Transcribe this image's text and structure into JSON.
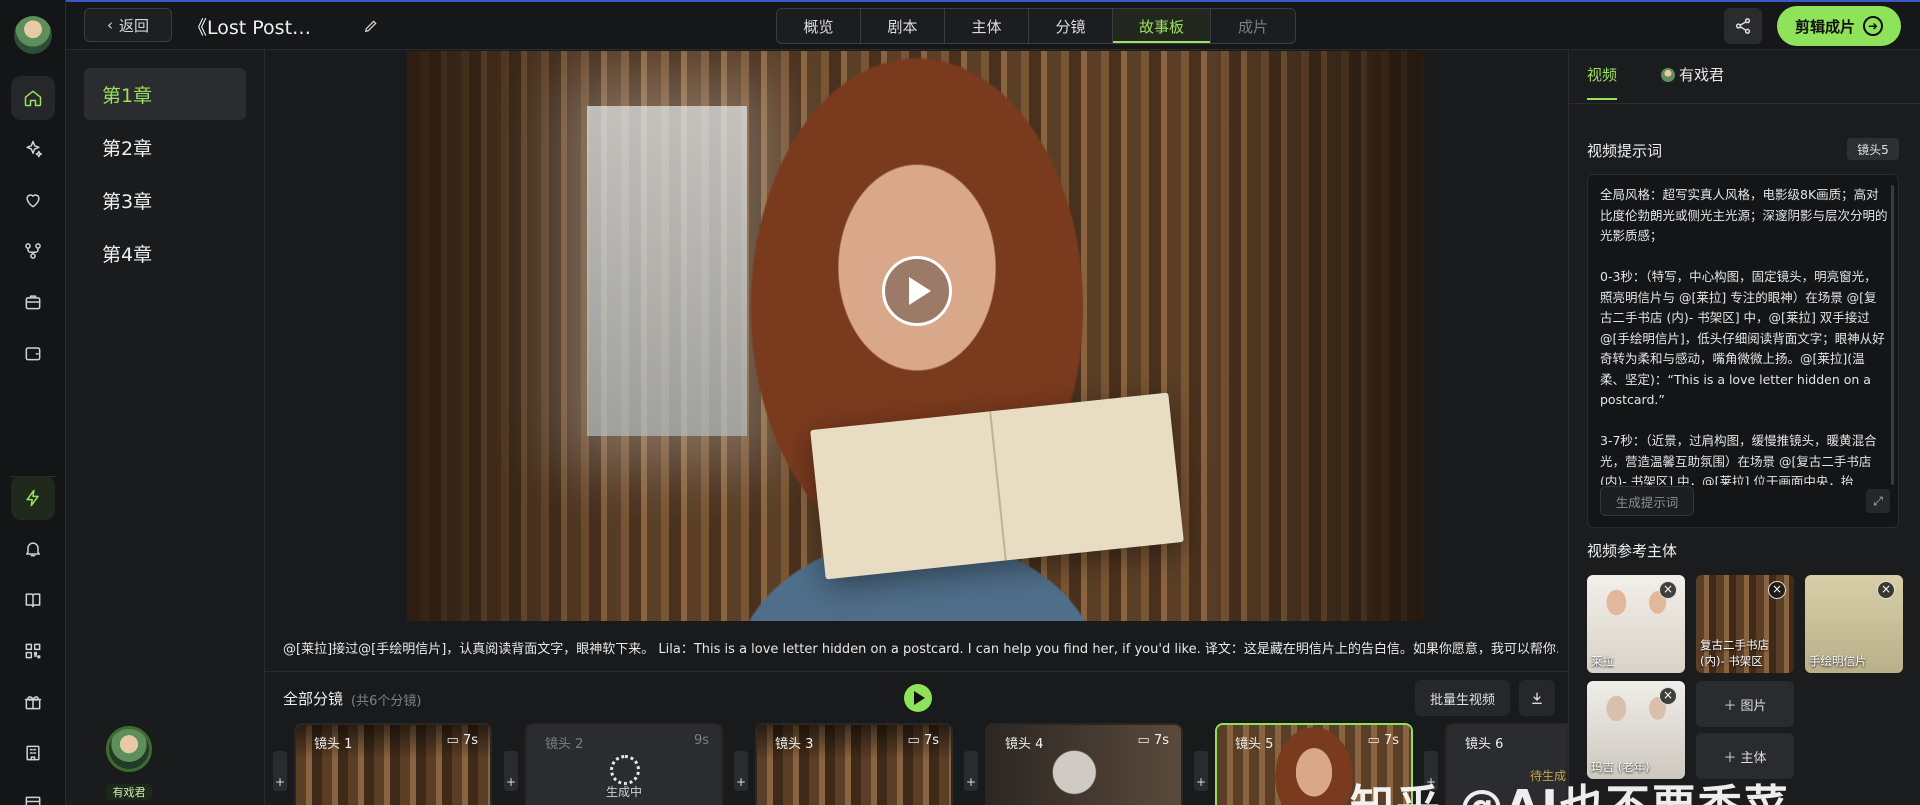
{
  "topbar": {
    "back_label": "返回",
    "project_title": "《Lost Post…",
    "tabs": [
      {
        "label": "概览"
      },
      {
        "label": "剧本"
      },
      {
        "label": "主体"
      },
      {
        "label": "分镜"
      },
      {
        "label": "故事板"
      },
      {
        "label": "成片"
      }
    ],
    "active_tab": "故事板",
    "cut_button": "剪辑成片"
  },
  "chapters": [
    "第1章",
    "第2章",
    "第3章",
    "第4章"
  ],
  "user": {
    "name": "有戏君"
  },
  "video": {
    "caption": "@[莱拉]接过@[手绘明信片]，认真阅读背面文字，眼神软下来。 Lila：This is a love letter hidden on a postcard. I can help you find her, if you'd like. 译文：这是藏在明信片上的告白信。如果你愿意，我可以帮你…"
  },
  "shots_section": {
    "title": "全部分镜",
    "count": "(共6个分镜)",
    "batch_button": "批量生视频",
    "shots": [
      {
        "label": "镜头 1",
        "duration": "7s",
        "status": ""
      },
      {
        "label": "镜头 2",
        "duration": "9s",
        "status": "生成中"
      },
      {
        "label": "镜头 3",
        "duration": "7s",
        "status": ""
      },
      {
        "label": "镜头 4",
        "duration": "7s",
        "status": ""
      },
      {
        "label": "镜头 5",
        "duration": "7s",
        "status": ""
      },
      {
        "label": "镜头 6",
        "duration": "",
        "status": "待生成"
      }
    ],
    "plus": "+"
  },
  "right_panel": {
    "tabs": [
      {
        "label": "视频"
      },
      {
        "label": "有戏君"
      }
    ],
    "prompt_title": "视频提示词",
    "shot_badge": "镜头5",
    "prompt_text": "全局风格：超写实真人风格，电影级8K画质；高对比度伦勃朗光或侧光主光源；深邃阴影与层次分明的光影质感；\n\n0-3秒：（特写，中心构图，固定镜头，明亮窗光，照亮明信片与 @[莱拉] 专注的眼神）在场景 @[复古二手书店 (内)- 书架区] 中，@[莱拉] 双手接过 @[手绘明信片]，低头仔细阅读背面文字；眼神从好奇转为柔和与感动，嘴角微微上扬。@[莱拉](温柔、坚定)：“This is a love letter hidden on a postcard.”\n\n3-7秒：（近景，过肩构图，缓慢推镜头，暖黄混合光，营造温馨互助氛围）在场景 @[复古二手书店 (内)- 书架区] 中，@[莱拉] 位于画面中央，抬",
    "gen_prompt_button": "生成提示词",
    "refs_title": "视频参考主体",
    "refs": [
      {
        "name": "莱拉"
      },
      {
        "name": "复古二手书店 (内)- 书架区"
      },
      {
        "name": "手绘明信片"
      },
      {
        "name": "玛吉 (老年)"
      }
    ],
    "add_image": "图片",
    "add_subject": "主体"
  },
  "watermark": "知乎 @AI也不要香菜",
  "colors": {
    "accent": "#8fe35a",
    "background": "#1a1b1d",
    "panel": "#141516"
  }
}
